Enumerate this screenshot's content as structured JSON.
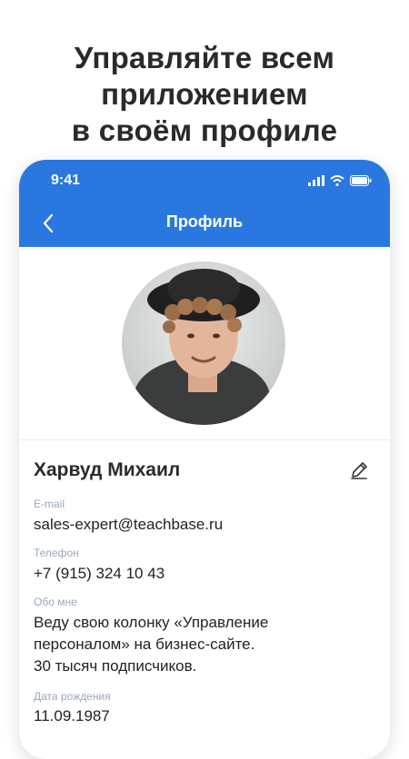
{
  "promo": {
    "line1": "Управляйте всем",
    "line2": "приложением",
    "line3": "в своём профиле"
  },
  "status_bar": {
    "time": "9:41",
    "icons": [
      "signal-icon",
      "wifi-icon",
      "battery-icon"
    ]
  },
  "header": {
    "back_icon": "chevron-left-icon",
    "title": "Профиль",
    "color": "#2a78df"
  },
  "profile": {
    "name": "Харвуд Михаил",
    "edit_icon": "pencil-icon",
    "fields": [
      {
        "label": "E-mail",
        "value": "sales-expert@teachbase.ru"
      },
      {
        "label": "Телефон",
        "value": "+7 (915) 324 10 43"
      },
      {
        "label": "Обо мне",
        "value_lines": [
          "Веду свою колонку «Управление",
          "персоналом» на бизнес-сайте.",
          "30 тысяч подписчиков."
        ]
      },
      {
        "label": "Дата рождения",
        "value": "11.09.1987"
      }
    ]
  }
}
